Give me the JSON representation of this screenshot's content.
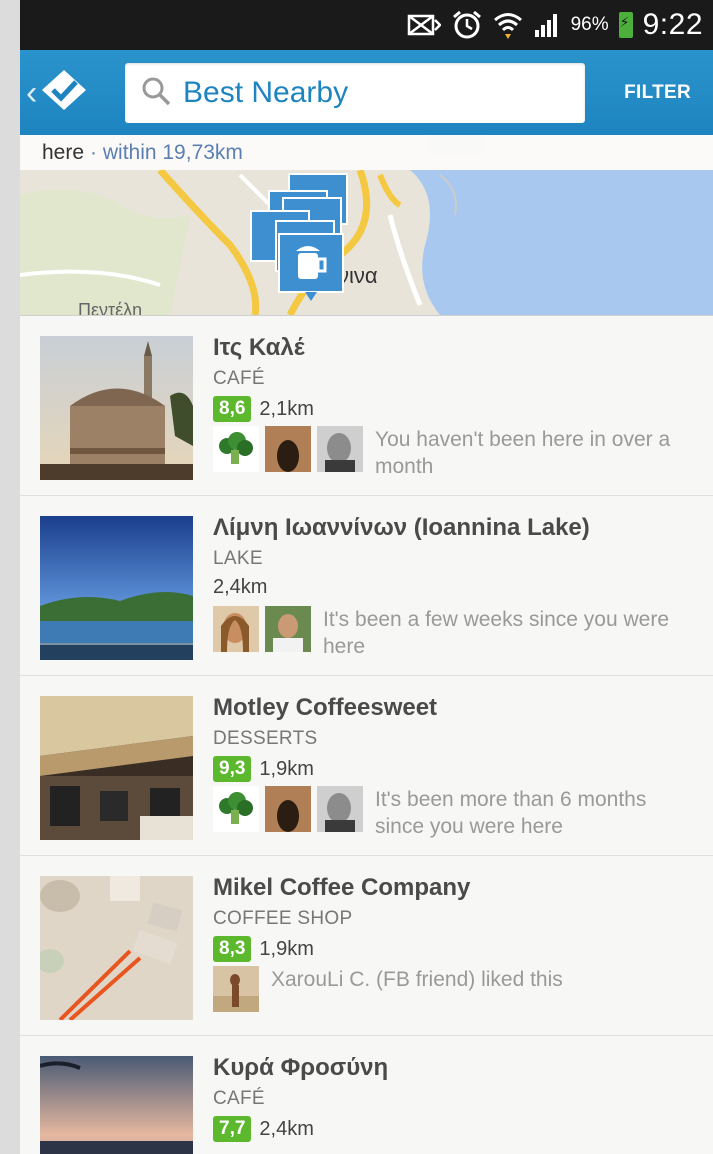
{
  "status_bar": {
    "battery_percent": "96%",
    "time": "9:22",
    "icons": [
      "no-signal-icon",
      "alarm-icon",
      "wifi-icon",
      "cell-signal-icon",
      "battery-charging-icon"
    ]
  },
  "app_bar": {
    "search_text": "Best Nearby",
    "filter_label": "FILTER",
    "logo": "foursquare-checkmark-icon"
  },
  "map": {
    "hint_prefix": "here",
    "hint_radius": "· within 19,73km",
    "place_label_1": "νινα",
    "place_label_2": "Πεντέλη"
  },
  "venues": [
    {
      "name": "Ιτς Καλέ",
      "category": "CAFÉ",
      "score": "8,6",
      "distance": "2,1km",
      "social_text": "You haven't been here in over a month"
    },
    {
      "name": "Λίμνη Ιωαννίνων (Ioannina Lake)",
      "category": "LAKE",
      "score": "",
      "distance": "2,4km",
      "social_text": "It's been a few weeks since you were here"
    },
    {
      "name": "Motley Coffeesweet",
      "category": "DESSERTS",
      "score": "9,3",
      "distance": "1,9km",
      "social_text": "It's been more than 6 months since you were here"
    },
    {
      "name": "Mikel Coffee Company",
      "category": "COFFEE SHOP",
      "score": "8,3",
      "distance": "1,9km",
      "social_text": "XarouLi C. (FB friend) liked this"
    },
    {
      "name": "Κυρά Φροσύνη",
      "category": "CAFÉ",
      "score": "7,7",
      "distance": "2,4km",
      "social_text": ""
    }
  ],
  "colors": {
    "accent": "#1d84bf",
    "score_green": "#5cb82c"
  }
}
